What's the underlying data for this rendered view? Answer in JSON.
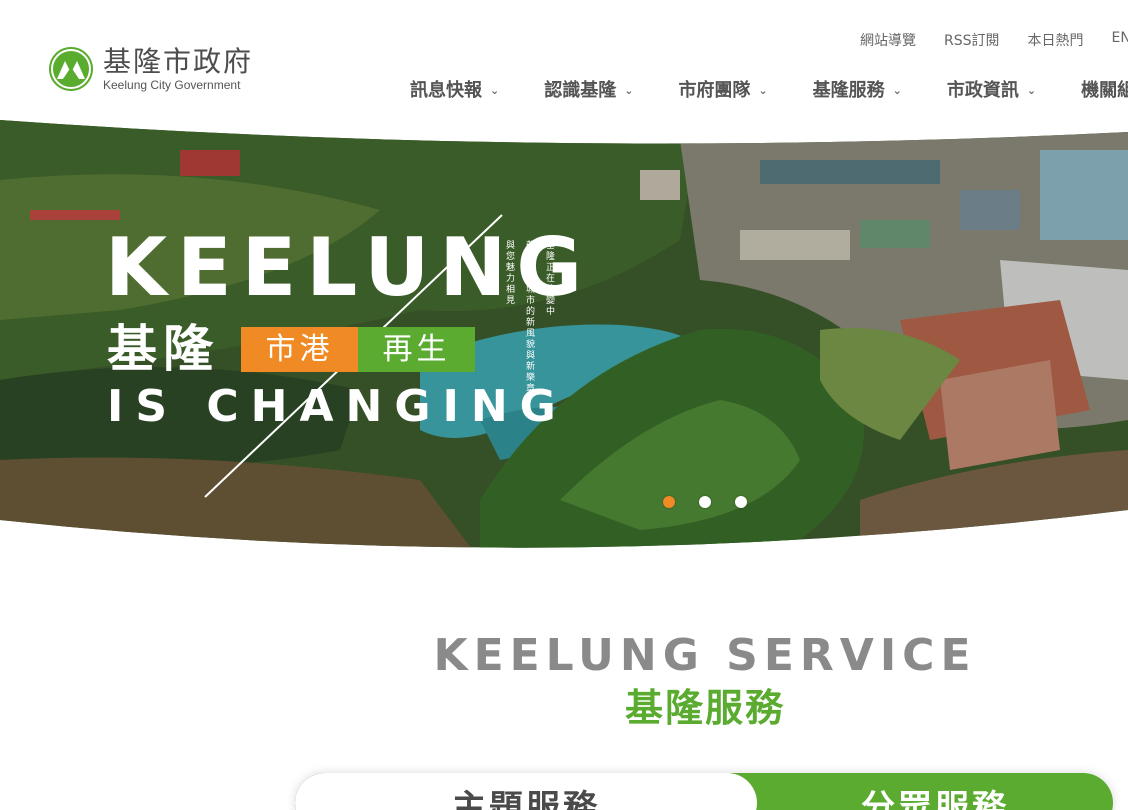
{
  "header": {
    "logo": {
      "name_zh": "基隆市政府",
      "name_en": "Keelung City Government"
    },
    "utility_links": [
      "網站導覽",
      "RSS訂閱",
      "本日熱門",
      "EN"
    ],
    "nav": [
      {
        "label": "訊息快報"
      },
      {
        "label": "認識基隆"
      },
      {
        "label": "市府團隊"
      },
      {
        "label": "基隆服務"
      },
      {
        "label": "市政資訊"
      },
      {
        "label": "機關組"
      }
    ]
  },
  "hero": {
    "title": "KEELUNG",
    "zh": "基隆",
    "tag_left": "市港",
    "tag_sep": "╳",
    "tag_right": "再生",
    "subtitle": "IS CHANGING",
    "vertical_text": [
      "基隆正在改變中",
      "帶來海洋城市的新風貌與新樂章",
      "與您魅力相見"
    ],
    "slides": {
      "count": 3,
      "active": 1
    }
  },
  "service": {
    "title_en": "KEELUNG SERVICE",
    "title_zh": "基隆服務",
    "tabs": [
      {
        "label": "主題服務",
        "active": true
      },
      {
        "label": "分眾服務",
        "active": false
      }
    ]
  },
  "colors": {
    "brand_green": "#5aab2f",
    "accent_orange": "#f08a24",
    "text_gray": "#555555"
  }
}
